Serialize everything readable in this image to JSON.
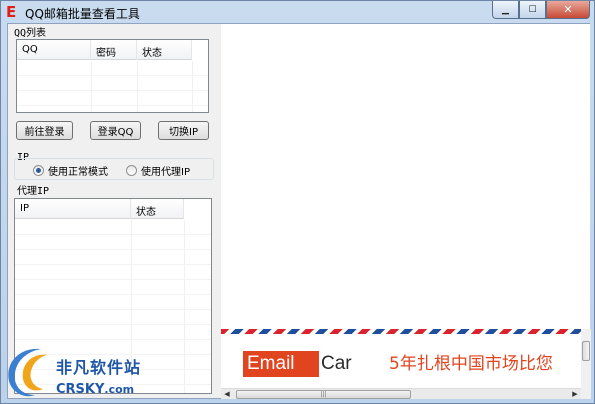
{
  "window": {
    "title": "QQ邮箱批量查看工具",
    "icon_glyph": "E",
    "controls": [
      "minimize-icon",
      "maximize-icon",
      "close-icon"
    ]
  },
  "qq_group": {
    "label": "QQ列表",
    "columns": [
      "QQ",
      "密码",
      "状态"
    ],
    "rows": []
  },
  "buttons": {
    "goto_login": "前往登录",
    "login_qq": "登录QQ",
    "switch_ip": "切换IP"
  },
  "ip_group": {
    "label": "IP",
    "options": [
      "使用正常模式",
      "使用代理IP"
    ],
    "selected": "使用正常模式"
  },
  "proxy_group": {
    "label": "代理IP",
    "columns": [
      "IP",
      "状态"
    ],
    "rows": []
  },
  "banner": {
    "brand_part1": "Email",
    "brand_part2": "Car",
    "slogan": "5年扎根中国市场比您",
    "colors": {
      "brand": "#e0451f",
      "airmail_red": "#d9232e",
      "airmail_blue": "#1f4f9c"
    }
  },
  "watermark": {
    "cn": "非凡软件站",
    "en": "CRSKY",
    "en_suffix": ".com"
  }
}
